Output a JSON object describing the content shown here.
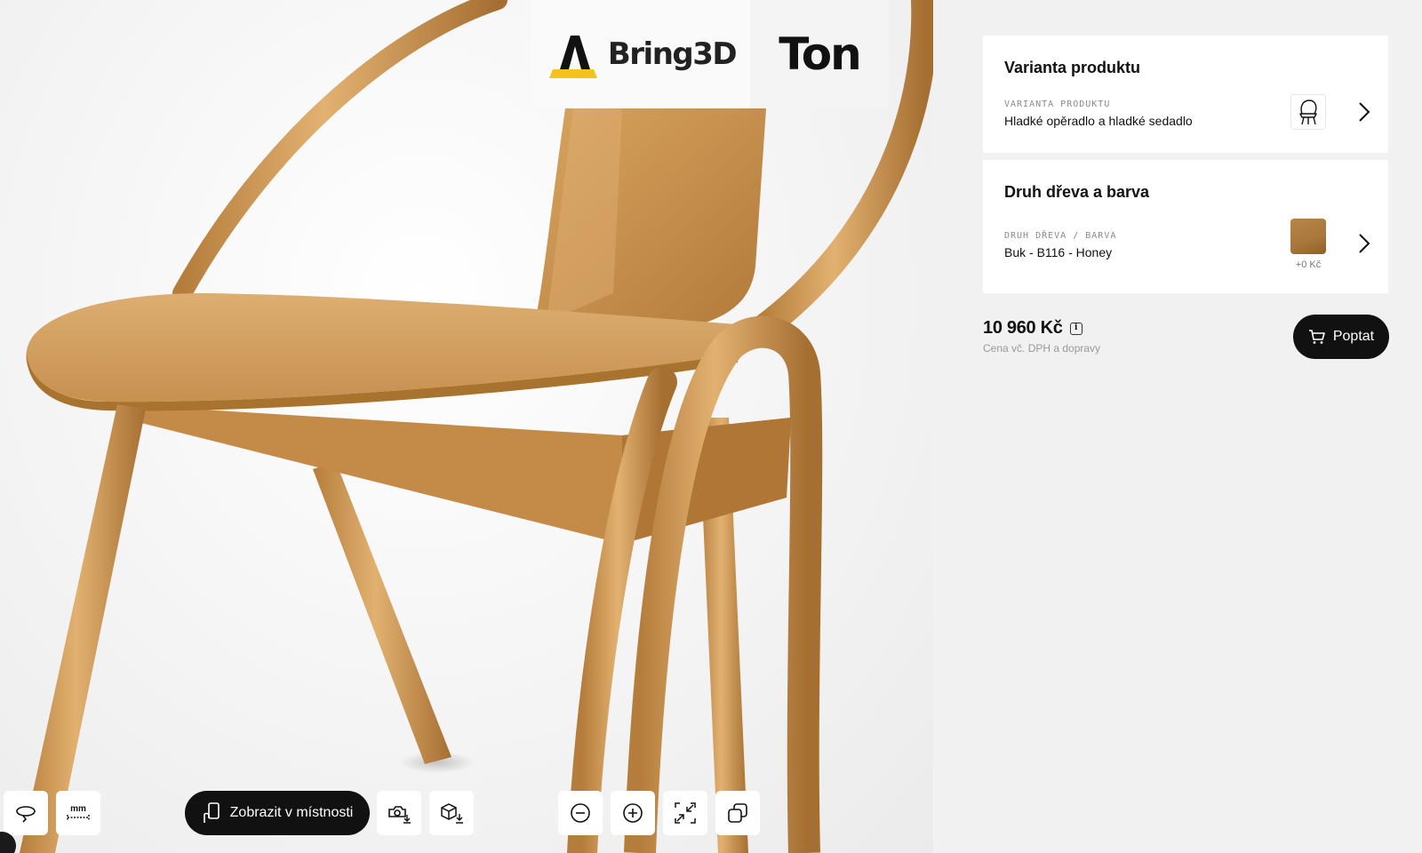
{
  "logos": {
    "bring3d": "Bring3D",
    "ton": "Ton"
  },
  "variant_card": {
    "title": "Varianta produktu",
    "kicker": "VARIANTA PRODUKTU",
    "value": "Hladké opěradlo a hladké sedadlo",
    "thumb_icon": "chair-icon"
  },
  "wood_card": {
    "title": "Druh dřeva a barva",
    "kicker": "DRUH DŘEVA / BARVA",
    "value": "Buk - B116 - Honey",
    "swatch_color": "#a9773c",
    "price_delta": "+0 Kč"
  },
  "pricing": {
    "price": "10 960 Kč",
    "info_glyph": "i",
    "note": "Cena vč. DPH a dopravy",
    "cta_label": "Poptat",
    "cta_icon": "cart-icon"
  },
  "toolbar": {
    "rotate_icon": "rotate-360-icon",
    "measure_label": "mm",
    "ar_label": "Zobrazit v místnosti",
    "ar_icon": "phone-hand-icon",
    "screenshot_icon": "camera-download-icon",
    "model_download_icon": "cube-download-icon",
    "zoom_out_icon": "zoom-out-icon",
    "zoom_in_icon": "zoom-in-icon",
    "fit_icon": "fit-view-icon",
    "compare_icon": "copy-icon"
  },
  "colors": {
    "wood_light": "#d9a966",
    "wood_mid": "#c38a45",
    "wood_dark": "#9b6a30",
    "ink": "#111111",
    "logo_yellow": "#f4c21a"
  }
}
